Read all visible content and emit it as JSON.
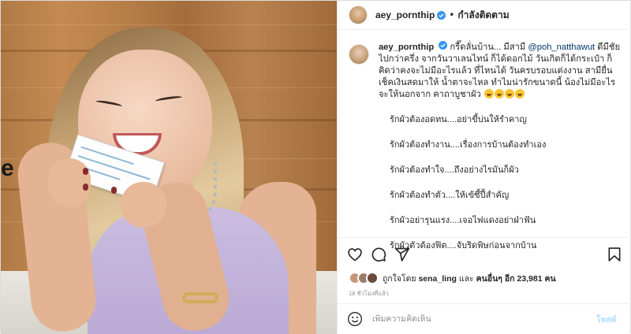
{
  "header": {
    "username": "aey_pornthip",
    "separator": "•",
    "follow_status": "กำลังติดตาม"
  },
  "caption": {
    "username": "aey_pornthip",
    "text_part1": "กรี๊ดลั่นบ้าน... มีสามี",
    "mention": "@poh_natthawut",
    "text_part2": "ดีมีชัยไปกว่าครึ่ง จากวันวาเลนไทน์ ก็ได้ดอกไม้ วันเกิดก็ได้กระเป๋า ก็คิดว่าคงจะไม่มีอะไรแล้ว ที่ไหนได้ วันครบรอบแต่งงาน สามียื่นเช็คเงินสดมาให้ น้ำตาจะไหล ทำไมน่ารักขนาดนี้ น้องไม่มีอะไรจะให้นอกจาก คาถาบูชาผัว",
    "lines": [
      "รักผัวต้องอดทน....อย่าขี้บ่นให้รำคาญ",
      "รักผัวต้องทำงาน....เรื่องการบ้านต้องทำเอง",
      "รักผัวต้องทำใจ....ถึงอย่างไรมันก็ผัว",
      "รักผัวต้องทำตัว....ให้เข้ซี้ปี้สำคัญ",
      "รักผัวอย่ารุนแรง....เจอไฟแดงอย่าฝ่าฟัน",
      "รักผัวตัวต้องฟิต....จับริดพิษก่อนจากบ้าน"
    ]
  },
  "likes": {
    "prefix": "ถูกใจโดย",
    "first_user": "sena_ling",
    "conj": "และ",
    "others": "คนอื่นๆ อีก 23,981 คน"
  },
  "timestamp": "18 ชั่วโมงที่แล้ว",
  "comment": {
    "placeholder": "เพิ่มความคิดเห็น",
    "post_label": "โพสต์"
  },
  "photo": {
    "wall_text": "e"
  },
  "colors": {
    "mention": "#00376b",
    "post_button": "#b2dffc",
    "verified": "#3897f0",
    "muted": "#8e8e8e"
  },
  "icons": [
    "heart-icon",
    "comment-icon",
    "share-icon",
    "bookmark-icon",
    "smiley-icon",
    "verified-icon"
  ]
}
